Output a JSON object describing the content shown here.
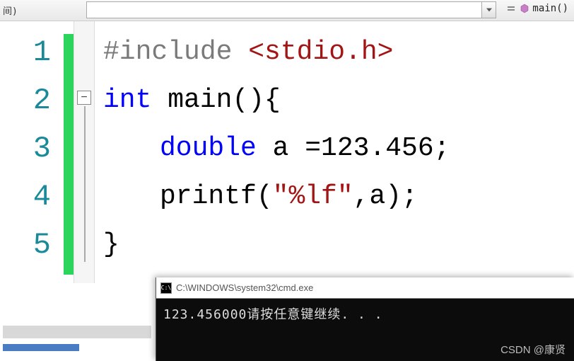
{
  "topbar": {
    "fragment": "间)",
    "function_label": "main()"
  },
  "editor": {
    "line_numbers": [
      "1",
      "2",
      "3",
      "4",
      "5"
    ],
    "fold_symbol": "−",
    "code": {
      "l1_directive": "#include",
      "l1_header": "<stdio.h>",
      "l2_kw": "int",
      "l2_rest": " main(){",
      "l3_kw": "double",
      "l3_rest": " a =123.456;",
      "l4_fn": "printf(",
      "l4_str": "\"%lf\"",
      "l4_rest": ",a);",
      "l5": "}"
    }
  },
  "console": {
    "title": "C:\\WINDOWS\\system32\\cmd.exe",
    "icon_text": "C:\\",
    "output": "123.456000请按任意键继续. . ."
  },
  "watermark": "CSDN @康贤"
}
